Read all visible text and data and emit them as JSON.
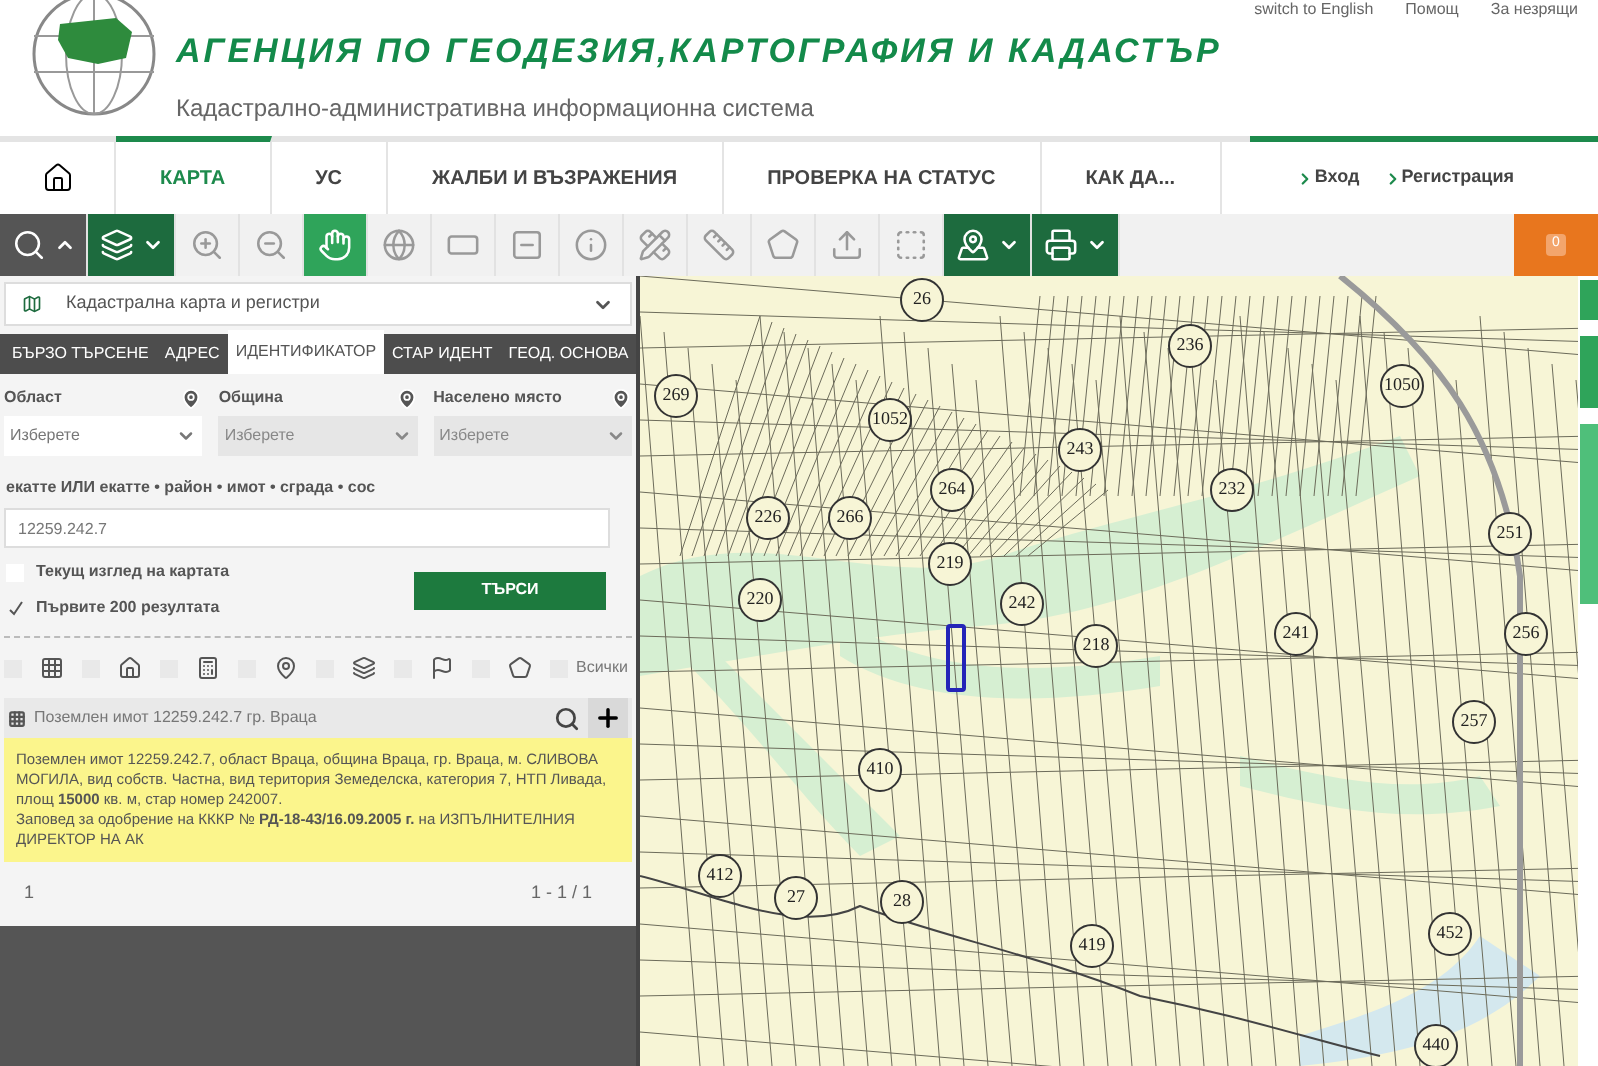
{
  "header": {
    "title": "АГЕНЦИЯ ПО ГЕОДЕЗИЯ,КАРТОГРАФИЯ И КАДАСТЪР",
    "subtitle": "Кадастрално-административна информационна система",
    "top_links": [
      "switch to English",
      "Помощ",
      "За незрящи"
    ]
  },
  "nav": {
    "tabs": [
      {
        "label": "КАРТА",
        "selected": true
      },
      {
        "label": "УС",
        "selected": false
      },
      {
        "label": "ЖАЛБИ И ВЪЗРАЖЕНИЯ",
        "selected": false
      },
      {
        "label": "ПРОВЕРКА НА СТАТУС",
        "selected": false
      },
      {
        "label": "КАК ДА...",
        "selected": false
      }
    ],
    "account_links": [
      "Вход",
      "Регистрация"
    ]
  },
  "toolbar": {
    "tools": [
      {
        "selected": false
      },
      {
        "selected": false
      },
      {
        "selected": false
      },
      {
        "selected": false
      },
      {
        "selected": true
      },
      {
        "selected": false
      },
      {
        "selected": false
      },
      {
        "selected": false
      },
      {
        "selected": false
      },
      {
        "selected": false
      },
      {
        "selected": false
      },
      {
        "selected": false
      },
      {
        "selected": false
      },
      {
        "selected": false
      },
      {
        "selected": false
      },
      {
        "selected": false
      }
    ],
    "badge": "0"
  },
  "panel": {
    "layer_select": "Кадастрална карта и регистри",
    "tabs": [
      {
        "label": "БЪРЗО ТЪРСЕНЕ",
        "selected": false
      },
      {
        "label": "АДРЕС",
        "selected": false
      },
      {
        "label": "ИДЕНТИФИКАТОР",
        "selected": true
      },
      {
        "label": "СТАР ИДЕНТ",
        "selected": false
      },
      {
        "label": "ГЕОД. ОСНОВА",
        "selected": false
      }
    ],
    "selects": [
      {
        "label": "Област",
        "value": "Изберете",
        "disabled": false
      },
      {
        "label": "Община",
        "value": "Изберете",
        "disabled": true
      },
      {
        "label": "Населено място",
        "value": "Изберете",
        "disabled": true
      }
    ],
    "identifier": {
      "label": "екатте ИЛИ екатте • район • имот • сграда • сос",
      "value": "12259.242.7"
    },
    "options": [
      {
        "label": "Текущ изглед на картата",
        "checked": false
      },
      {
        "label": "Първите 200 резултата",
        "checked": true
      }
    ],
    "search_button": "ТЪРСИ",
    "filters": [
      {
        "checked": false
      },
      {
        "checked": false
      },
      {
        "checked": false
      },
      {
        "checked": false
      },
      {
        "checked": false
      },
      {
        "checked": false
      },
      {
        "checked": false
      },
      {
        "checked": false,
        "label": "Всички"
      }
    ],
    "result": {
      "title": "Поземлен имот 12259.242.7 гр. Враца",
      "details": [
        "Поземлен имот 12259.242.7, област Враца, община Враца, гр. Враца, м. СЛИВОВА МОГИЛА, вид собств. Частна, вид територия Земеделска, категория 7, НТП Ливада, площ **15000** кв. м, стар номер 242007.",
        "Заповед за одобрение на КККР № **РД-18-43/16.09.2005 г.** на ИЗПЪЛНИТЕЛНИЯ ДИРЕКТОР НА АК"
      ],
      "page": "1",
      "range": "1 - 1 / 1"
    }
  },
  "map": {
    "parcel_labels": [
      "26",
      "236",
      "269",
      "1052",
      "1050",
      "243",
      "232",
      "264",
      "226",
      "266",
      "219",
      "251",
      "220",
      "242",
      "241",
      "218",
      "256",
      "410",
      "257",
      "412",
      "419",
      "452",
      "440",
      "27",
      "28"
    ]
  }
}
